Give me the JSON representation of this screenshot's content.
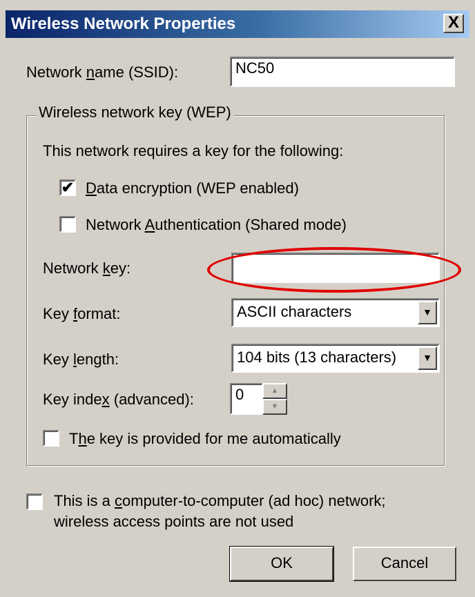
{
  "window": {
    "title": "Wireless Network Properties",
    "close_label": "X"
  },
  "ssid": {
    "label_pre": "Network ",
    "label_u": "n",
    "label_post": "ame (SSID):",
    "value": "NC50"
  },
  "group": {
    "legend": "Wireless network key (WEP)",
    "intro": "This network requires a key for the following:",
    "data_encryption": {
      "u": "D",
      "rest": "ata encryption (WEP enabled)",
      "checked": "✔"
    },
    "network_auth": {
      "pre": "Network ",
      "u": "A",
      "rest": "uthentication (Shared mode)"
    },
    "network_key": {
      "pre": "Network ",
      "u": "k",
      "rest": "ey:",
      "value": ""
    },
    "key_format": {
      "pre": "Key ",
      "u": "f",
      "rest": "ormat:",
      "value": "ASCII characters"
    },
    "key_length": {
      "pre": "Key ",
      "u": "l",
      "rest": "ength:",
      "value": "104 bits (13 characters)"
    },
    "key_index": {
      "pre": "Key inde",
      "u": "x",
      "rest": " (advanced):",
      "value": "0"
    },
    "auto_key": {
      "pre": "T",
      "u": "h",
      "rest": "e key is provided for me automatically"
    }
  },
  "adhoc": {
    "line1_pre": "This is a ",
    "line1_u": "c",
    "line1_rest": "omputer-to-computer (ad hoc) network;",
    "line2": "wireless access points are not used"
  },
  "buttons": {
    "ok": "OK",
    "cancel": "Cancel"
  }
}
